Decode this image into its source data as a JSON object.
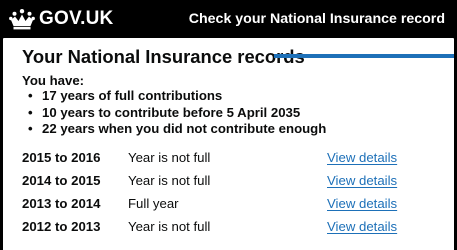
{
  "header": {
    "logo_text": "GOV.UK",
    "logo_icon": "crown-icon",
    "service_name": "Check your National Insurance record",
    "background_color": "#000000"
  },
  "main": {
    "title": "Your National Insurance records",
    "accent_color": "#1d70b8",
    "summary": {
      "intro": "You have:",
      "items": [
        "17 years of full contributions",
        "10 years to contribute before 5 April 2035",
        "22 years when you did not contribute enough"
      ]
    },
    "records": [
      {
        "year": "2015 to 2016",
        "status": "Year is not full",
        "link": "View details"
      },
      {
        "year": "2014 to 2015",
        "status": "Year is not full",
        "link": "View details"
      },
      {
        "year": "2013 to 2014",
        "status": "Full year",
        "link": "View details"
      },
      {
        "year": "2012 to 2013",
        "status": "Year is not full",
        "link": "View details"
      }
    ]
  }
}
